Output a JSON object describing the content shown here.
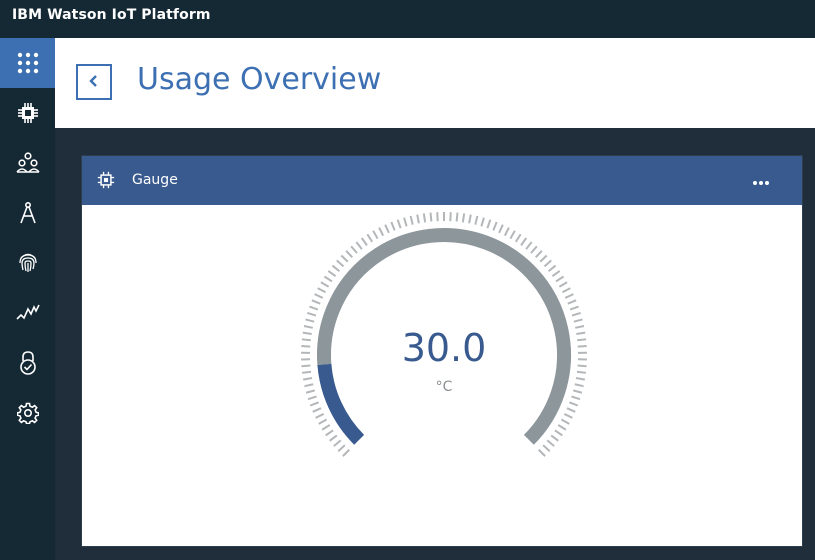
{
  "app": {
    "title": "IBM Watson IoT Platform"
  },
  "sidebar": {
    "items": [
      {
        "name": "apps-grid",
        "icon": "grid-icon",
        "active": true
      },
      {
        "name": "devices",
        "icon": "chip-icon",
        "active": false
      },
      {
        "name": "members",
        "icon": "people-icon",
        "active": false
      },
      {
        "name": "rules",
        "icon": "compass-icon",
        "active": false
      },
      {
        "name": "security",
        "icon": "fingerprint-icon",
        "active": false
      },
      {
        "name": "analytics",
        "icon": "activity-icon",
        "active": false
      },
      {
        "name": "risk",
        "icon": "lock-check-icon",
        "active": false
      },
      {
        "name": "settings",
        "icon": "gear-icon",
        "active": false
      }
    ]
  },
  "header": {
    "back_icon": "chevron-left-icon",
    "title": "Usage Overview"
  },
  "card": {
    "icon": "chip-icon",
    "title": "Gauge",
    "menu_icon": "overflow-menu-icon"
  },
  "gauge": {
    "value": "30.0",
    "unit": "°C",
    "fill_fraction": 0.15,
    "colors": {
      "fill": "#385a8e",
      "track": "#8d969b",
      "ticks": "#b4b7b9",
      "value_text": "#385a8e",
      "unit_text": "#8b8f92"
    }
  },
  "colors": {
    "topbar": "#152935",
    "sidebar_active": "#3d70b2",
    "page_bg": "#1f2e3a",
    "card_header": "#385a8e",
    "accent": "#3d70b2"
  }
}
